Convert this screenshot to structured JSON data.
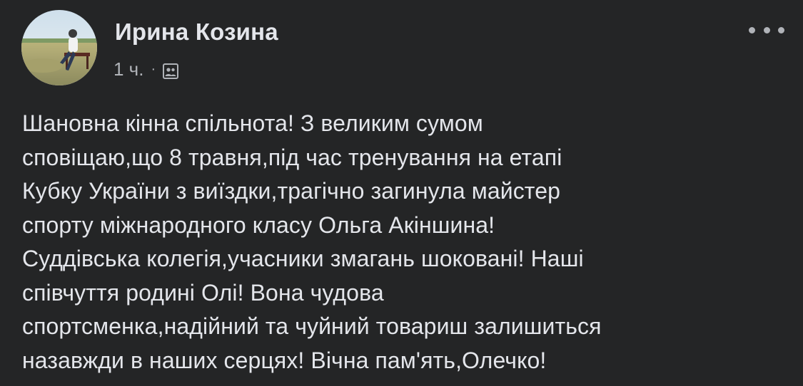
{
  "post": {
    "author_name": "Ирина Козина",
    "timestamp": "1 ч.",
    "separator": "·",
    "audience_icon": "friends-icon",
    "more_icon": "more-horizontal-icon",
    "text_lines": [
      "Шановна кінна спільнота! З великим сумом",
      "сповіщаю,що 8 травня,під час тренування на етапі",
      "Кубку України з виїздки,трагічно загинула майстер",
      "спорту міжнародного класу Ольга Акіншина!",
      "Суддівська колегія,учасники змагань шоковані! Наші",
      "співчуття родині Олі! Вона чудова",
      "спортсменка,надійний та чуйний товариш залишиться",
      "назавжди в наших серцях! Вічна пам'ять,Олечко!"
    ]
  },
  "colors": {
    "background": "#242526",
    "primary_text": "#e4e6eb",
    "secondary_text": "#b0b3b8"
  }
}
